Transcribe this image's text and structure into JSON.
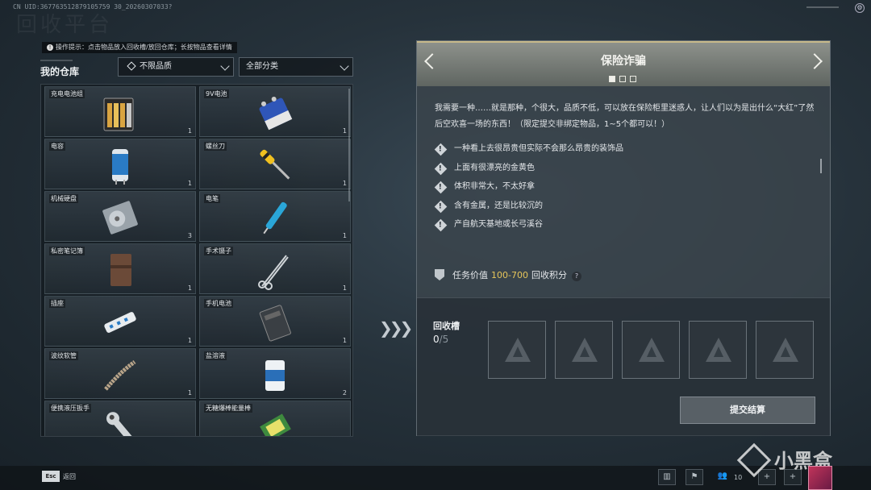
{
  "header": {
    "uid": "CN UID:367763512879105759 30_20260307033?",
    "bg_title": "回收平台"
  },
  "left": {
    "hint": "操作提示：点击物品放入回收槽/放回仓库；长按物品查看详情",
    "title": "我的仓库",
    "quality_filter": "不限品质",
    "category_filter": "全部分类",
    "items": [
      {
        "name": "充电电池组",
        "qty": "1",
        "icon": "battery-pack-icon"
      },
      {
        "name": "9V电池",
        "qty": "1",
        "icon": "9v-battery-icon"
      },
      {
        "name": "电容",
        "qty": "1",
        "icon": "capacitor-icon"
      },
      {
        "name": "螺丝刀",
        "qty": "1",
        "icon": "screwdriver-icon"
      },
      {
        "name": "机械硬盘",
        "qty": "3",
        "icon": "hard-disk-icon"
      },
      {
        "name": "电笔",
        "qty": "1",
        "icon": "test-pen-icon"
      },
      {
        "name": "私密笔记簿",
        "qty": "1",
        "icon": "notebook-icon"
      },
      {
        "name": "手术镊子",
        "qty": "1",
        "icon": "forceps-icon"
      },
      {
        "name": "插座",
        "qty": "1",
        "icon": "power-strip-icon"
      },
      {
        "name": "手机电池",
        "qty": "1",
        "icon": "phone-battery-icon"
      },
      {
        "name": "波纹软管",
        "qty": "1",
        "icon": "hose-icon"
      },
      {
        "name": "盐溶液",
        "qty": "2",
        "icon": "saline-icon"
      },
      {
        "name": "便携液压扳手",
        "qty": "",
        "icon": "wrench-icon"
      },
      {
        "name": "无糖爆棒能量棒",
        "qty": "",
        "icon": "energy-bar-icon"
      }
    ]
  },
  "panel": {
    "title": "保险诈骗",
    "description": "我需要一种……就是那种，个很大，品质不低，可以放在保险柜里迷惑人，让人们以为是出什么“大红”了然后空欢喜一场的东西！（限定提交非绑定物品，1~5个都可以！）",
    "clues": [
      "一种看上去很昂贵但实际不会那么昂贵的装饰品",
      "上面有很漂亮的金黄色",
      "体积非常大，不太好拿",
      "含有金属，还是比较沉的",
      "产自航天基地或长弓溪谷"
    ],
    "value_label": "任务价值",
    "value_range": "100-700",
    "value_unit": "回收积分",
    "slot_label": "回收槽",
    "slot_filled": "0",
    "slot_total": "/5",
    "submit_label": "提交结算"
  },
  "footer": {
    "esc": "Esc",
    "back": "返回",
    "friends_count": "10"
  },
  "watermark": "小黑盒",
  "colors": {
    "accent_gold": "#e6c55a",
    "header_border": "#c7b98a"
  }
}
